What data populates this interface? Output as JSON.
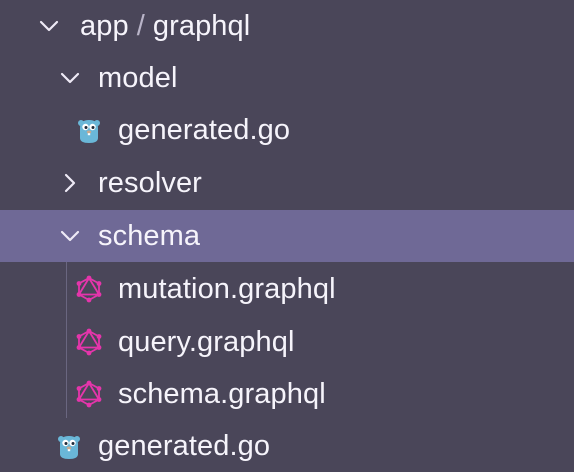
{
  "explorer": {
    "root": {
      "segment1": "app",
      "separator": "/",
      "segment2": "graphql",
      "expanded": true
    },
    "items": [
      {
        "label": "model",
        "type": "folder",
        "expanded": true,
        "icon": "chevron-down-icon"
      },
      {
        "label": "generated.go",
        "type": "file",
        "icon": "go-gopher-icon"
      },
      {
        "label": "resolver",
        "type": "folder",
        "expanded": false,
        "icon": "chevron-right-icon"
      },
      {
        "label": "schema",
        "type": "folder",
        "expanded": true,
        "selected": true,
        "icon": "chevron-down-icon"
      },
      {
        "label": "mutation.graphql",
        "type": "file",
        "icon": "graphql-icon"
      },
      {
        "label": "query.graphql",
        "type": "file",
        "icon": "graphql-icon"
      },
      {
        "label": "schema.graphql",
        "type": "file",
        "icon": "graphql-icon"
      },
      {
        "label": "generated.go",
        "type": "file",
        "icon": "go-gopher-icon"
      }
    ]
  },
  "colors": {
    "background": "#4a4659",
    "selection": "#6f6996",
    "text": "#f6f4fb",
    "graphql_pink": "#e535ab",
    "go_blue": "#6ab7d8"
  }
}
